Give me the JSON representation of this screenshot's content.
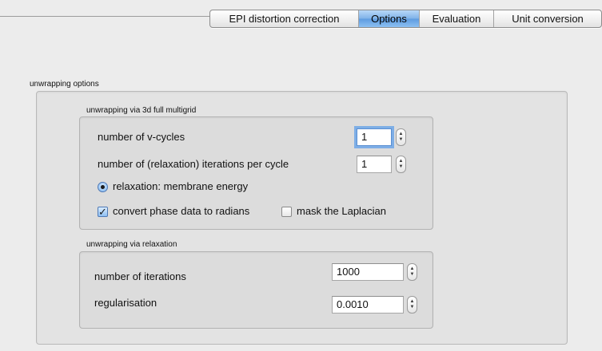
{
  "tabs": [
    {
      "label": "EPI distortion correction",
      "active": false
    },
    {
      "label": "Options",
      "active": true
    },
    {
      "label": "Evaluation",
      "active": false
    },
    {
      "label": "Unit conversion",
      "active": false
    }
  ],
  "unwrapping_options": {
    "title": "unwrapping options",
    "multigrid": {
      "title": "unwrapping via 3d full multigrid",
      "vcycles_label": "number of v-cycles",
      "vcycles_value": "1",
      "iterations_label": "number of (relaxation) iterations per cycle",
      "iterations_value": "1",
      "relaxation_radio_label": "relaxation: membrane energy",
      "relaxation_selected": true,
      "convert_label": "convert phase data to radians",
      "convert_checked": true,
      "mask_label": "mask the Laplacian",
      "mask_checked": false
    },
    "relaxation": {
      "title": "unwrapping via relaxation",
      "iterations_label": "number of iterations",
      "iterations_value": "1000",
      "regularisation_label": "regularisation",
      "regularisation_value": "0.0010"
    }
  },
  "icons": {
    "stepper": "stepper-arrows-icon",
    "radio": "radio-selected-icon",
    "check": "checkmark-icon"
  },
  "colors": {
    "window_bg": "#ececec",
    "active_tab": "#6ea6e6",
    "focus_ring": "#7eaee6"
  }
}
